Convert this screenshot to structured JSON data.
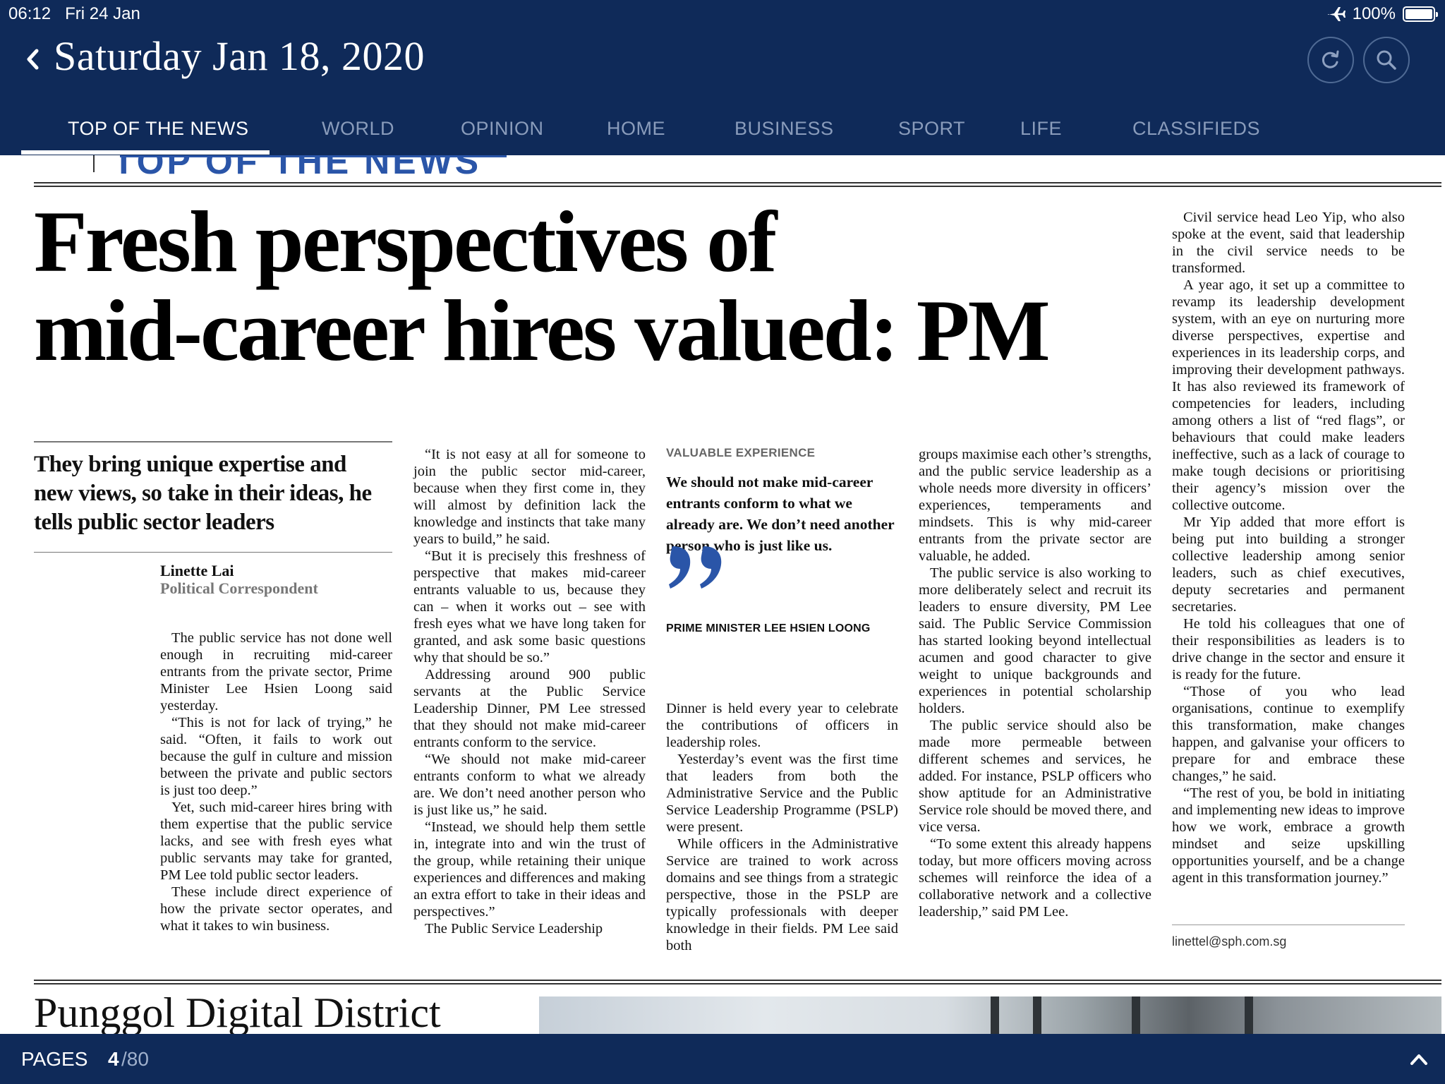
{
  "status_bar": {
    "time": "06:12",
    "date": "Fri 24 Jan",
    "battery": "100%",
    "airplane_icon": "airplane-icon"
  },
  "header": {
    "edition_date": "Saturday Jan 18, 2020",
    "back_icon": "chevron-left-icon",
    "refresh_icon": "refresh-icon",
    "search_icon": "search-icon"
  },
  "tabs": [
    {
      "label": "TOP OF THE NEWS",
      "active": true
    },
    {
      "label": "WORLD"
    },
    {
      "label": "OPINION"
    },
    {
      "label": "HOME"
    },
    {
      "label": "BUSINESS"
    },
    {
      "label": "SPORT"
    },
    {
      "label": "LIFE"
    },
    {
      "label": "CLASSIFIEDS"
    }
  ],
  "article": {
    "section_label": "TOP OF THE NEWS",
    "headline_line1": "Fresh perspectives of",
    "headline_line2": "mid-career hires valued: PM",
    "subheading": "They bring unique expertise and new views, so take in their ideas, he tells public sector leaders",
    "byline_name": "Linette Lai",
    "byline_role": "Political Correspondent",
    "col1": [
      "The public service has not done well enough in recruiting mid-career entrants from the private sector, Prime Minister Lee Hsien Loong said yesterday.",
      "“This is not for lack of trying,” he said. “Often, it fails to work out because the gulf in culture and mission between the private and public sectors is just too deep.”",
      "Yet, such mid-career hires bring with them expertise that the public service lacks, and see with fresh eyes what public servants may take for granted, PM Lee told public sector leaders.",
      "These include direct experience of how the private sector operates, and what it takes to win business."
    ],
    "col2": [
      "“It is not easy at all for someone to join the public sector mid-career, because when they first come in, they will almost by definition lack the knowledge and instincts that take many years to build,” he said.",
      "“But it is precisely this freshness of perspective that makes mid-career entrants valuable to us, because they can – when it works out – see with fresh eyes what we have long taken for granted, and ask some basic questions why that should be so.”",
      "Addressing around 900 public servants at the Public Service Leadership Dinner, PM Lee stressed that they should not make mid-career entrants conform to the service.",
      "“We should not make mid-career entrants conform to what we already are. We don’t need another person who is just like us,” he said.",
      "“Instead, we should help them settle in, integrate into and win the trust of the group, while retaining their unique experiences and differences and making an extra effort to take in their ideas and perspectives.”",
      "The Public Service Leadership"
    ],
    "pullquote": {
      "kicker": "VALUABLE EXPERIENCE",
      "text": "We should not make mid-career entrants conform to what we already are. We don’t need another person who is just like us.",
      "attribution": "PRIME MINISTER LEE HSIEN LOONG",
      "quote_icon": "quote-icon",
      "accent_color": "#2a55a8"
    },
    "col3": [
      "Dinner is held every year to celebrate the contributions of officers in leadership roles.",
      "Yesterday’s event was the first time that leaders from both the Administrative Service and the Public Service Leadership Programme (PSLP) were present.",
      "While officers in the Administrative Service are trained to work across domains and see things from a strategic perspective, those in the PSLP are typically professionals with deeper knowledge in their fields. PM Lee said both"
    ],
    "col4": [
      "groups maximise each other’s strengths, and the public service leadership as a whole needs more diversity in officers’ experiences, temperaments and mindsets. This is why mid-career entrants from the private sector are valuable, he added.",
      "The public service is also working to more deliberately select and recruit its leaders to ensure diversity, PM Lee said. The Public Service Commission has started looking beyond intellectual acumen and good character to give weight to unique backgrounds and experiences in potential scholarship holders.",
      "The public service should also be made more permeable between different schemes and services, he added. For instance, PSLP officers who show aptitude for an Administrative Service role should be moved there, and vice versa.",
      "“To some extent this already happens today, but more officers moving across schemes will reinforce the idea of a collaborative network and a collective leadership,” said PM Lee."
    ],
    "col5": [
      "Civil service head Leo Yip, who also spoke at the event, said that leadership in the civil service needs to be transformed.",
      "A year ago, it set up a committee to revamp its leadership development system, with an eye on nurturing more diverse perspectives, expertise and experiences in its leadership corps, and improving their development pathways. It has also reviewed its framework of competencies for leaders, including among others a list of “red flags”, or behaviours that could make leaders ineffective, such as a lack of courage to make tough decisions or prioritising their agency’s mission over the collective outcome.",
      "Mr Yip added that more effort is being put into building a stronger collective leadership among senior leaders, such as chief executives, deputy secretaries and permanent secretaries.",
      "He told his colleagues that one of their responsibilities as leaders is to drive change in the sector and ensure it is ready for the future.",
      "“Those of you who lead organisations, continue to exemplify this transformation, make changes happen, and galvanise your officers to prepare for and embrace these changes,” he said.",
      "“The rest of you, be bold in initiating and implementing new ideas to improve how we work, embrace a growth mindset and seize upskilling opportunities yourself, and be a change agent in this transformation journey.”"
    ],
    "email": "linettel@sph.com.sg"
  },
  "next_article": {
    "headline": "Punggol Digital District"
  },
  "footer": {
    "pages_label": "PAGES",
    "current_page": "4",
    "total_pages": "/80",
    "expand_icon": "chevron-up-icon"
  },
  "colors": {
    "navy": "#0f2a59",
    "inactive_tab": "#8a9cbb",
    "accent_blue": "#2a55a8"
  }
}
